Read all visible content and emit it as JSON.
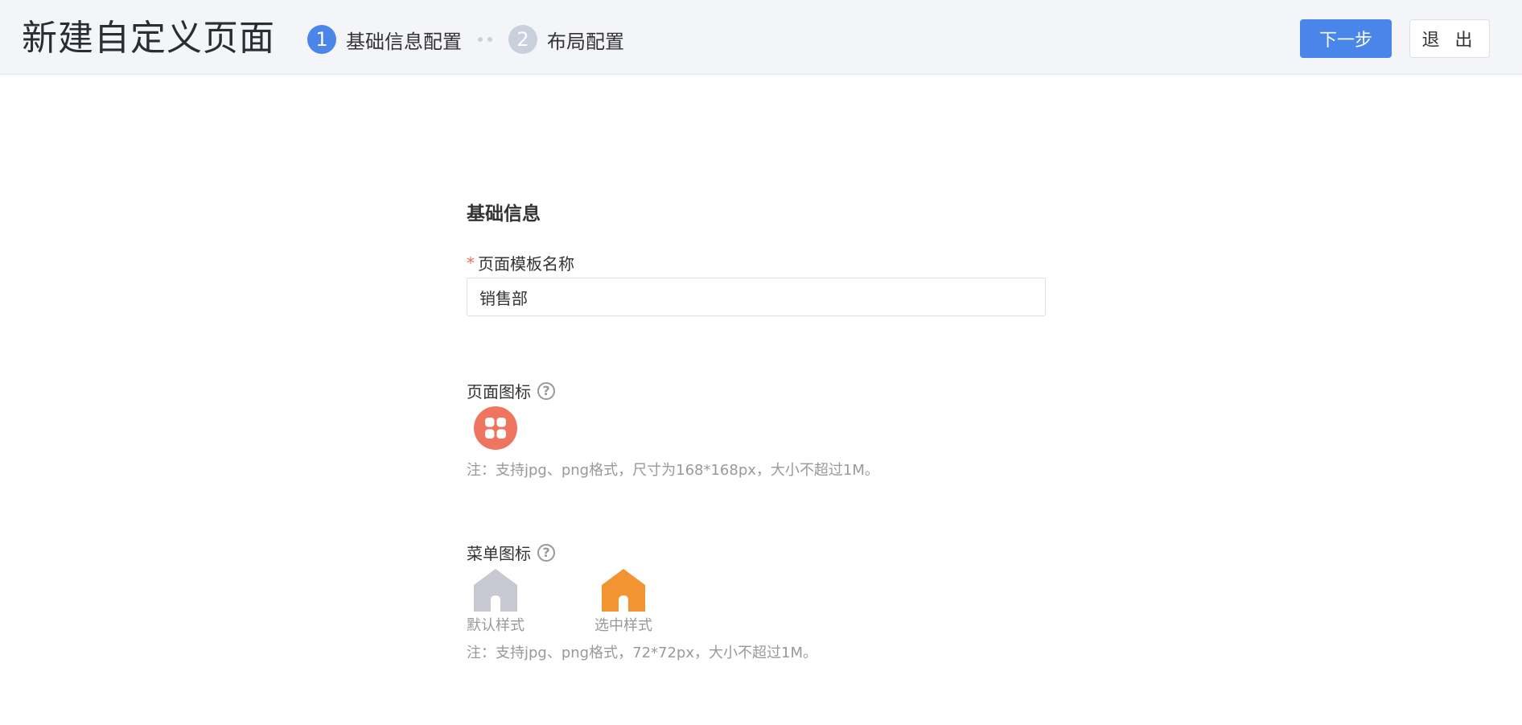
{
  "header": {
    "title": "新建自定义页面",
    "steps": [
      {
        "number": "1",
        "label": "基础信息配置",
        "state": "active"
      },
      {
        "number": "2",
        "label": "布局配置",
        "state": "inactive"
      }
    ],
    "next_label": "下一步",
    "exit_label": "退 出"
  },
  "form": {
    "section_title": "基础信息",
    "name_field": {
      "required_mark": "*",
      "label": "页面模板名称",
      "value": "销售部"
    },
    "page_icon": {
      "label": "页面图标",
      "help": "?",
      "icon": "apps-grid-icon",
      "color": "#ee7660",
      "note": "注：支持jpg、png格式，尺寸为168*168px，大小不超过1M。"
    },
    "menu_icon": {
      "label": "菜单图标",
      "help": "?",
      "default_caption": "默认样式",
      "default_color": "#c7c8d1",
      "selected_caption": "选中样式",
      "selected_color": "#f39433",
      "icon": "home-icon",
      "note": "注：支持jpg、png格式，72*72px，大小不超过1M。"
    }
  },
  "colors": {
    "primary": "#4a86ea",
    "header_bg": "#f4f5f8"
  }
}
